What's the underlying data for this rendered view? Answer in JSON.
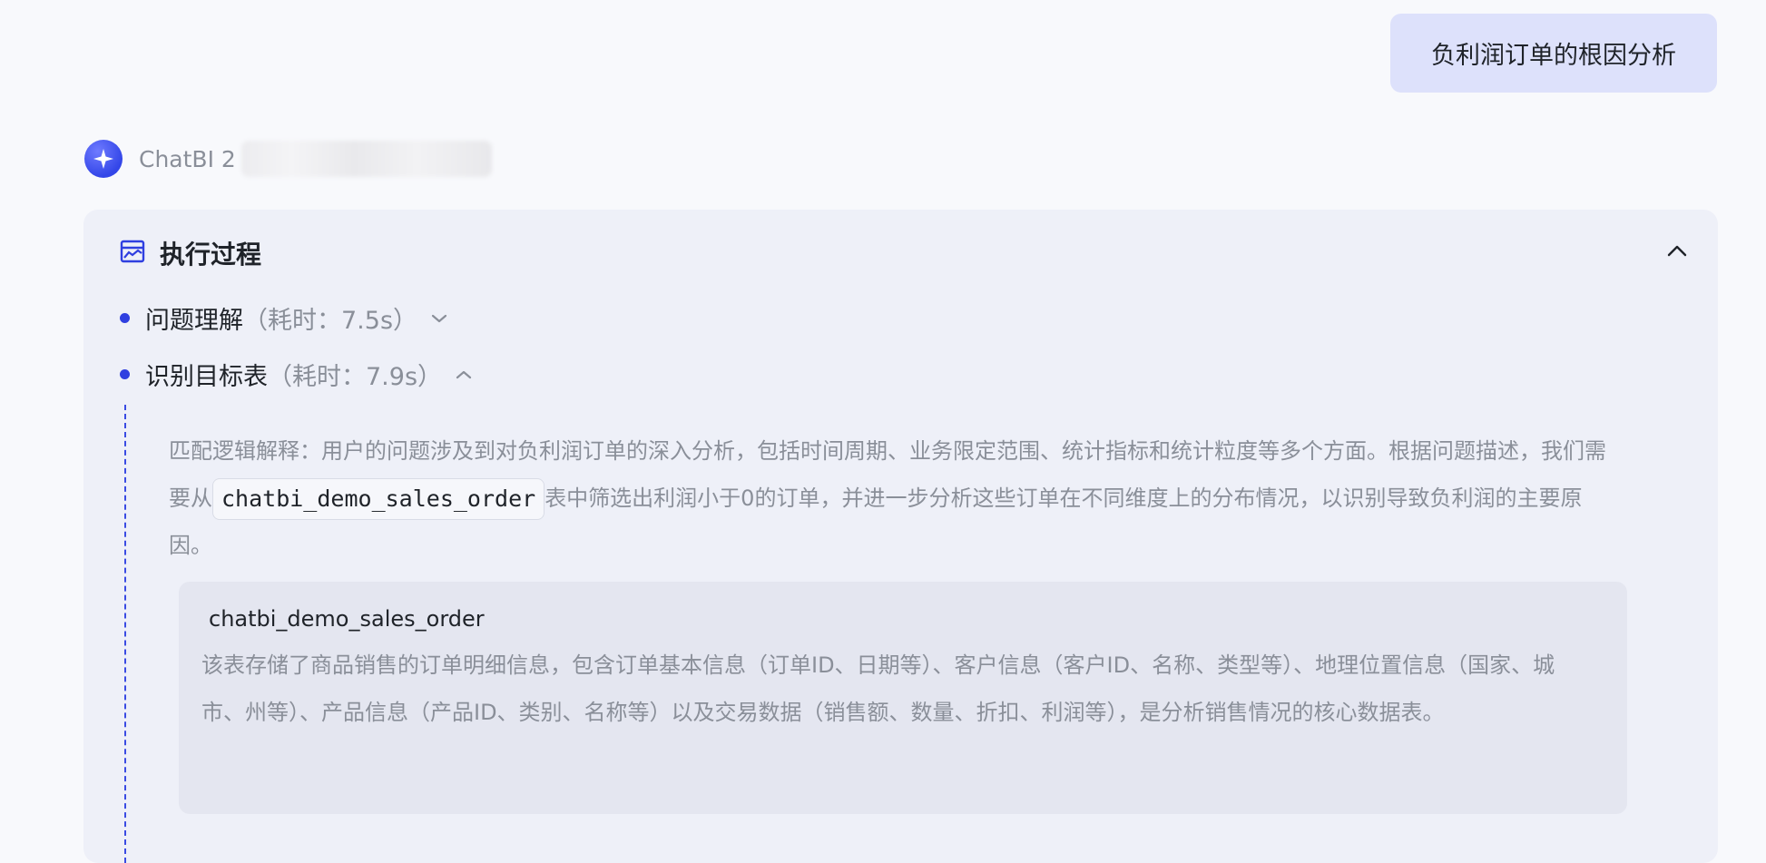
{
  "user_message": "负利润订单的根因分析",
  "bot": {
    "name": "ChatBI 2",
    "avatar_icon": "sparkle-icon"
  },
  "panel": {
    "title": "执行过程",
    "title_icon": "chart-window-icon",
    "collapse_icon": "chevron-up-icon",
    "steps": [
      {
        "name": "问题理解",
        "time": "（耗时：7.5s）",
        "expanded": false
      },
      {
        "name": "识别目标表",
        "time": "（耗时：7.9s）",
        "expanded": true
      }
    ],
    "explanation": {
      "before": "匹配逻辑解释：用户的问题涉及到对负利润订单的深入分析，包括时间周期、业务限定范围、统计指标和统计粒度等多个方面。根据问题描述，我们需要从",
      "code": "chatbi_demo_sales_order",
      "after": "表中筛选出利润小于0的订单，并进一步分析这些订单在不同维度上的分布情况，以识别导致负利润的主要原因。"
    },
    "table": {
      "name": "chatbi_demo_sales_order",
      "description": "该表存储了商品销售的订单明细信息，包含订单基本信息（订单ID、日期等）、客户信息（客户ID、名称、类型等）、地理位置信息（国家、城市、州等）、产品信息（产品ID、类别、名称等）以及交易数据（销售额、数量、折扣、利润等），是分析销售情况的核心数据表。"
    }
  },
  "colors": {
    "accent": "#2f3fe0",
    "bubble": "#dde1fb",
    "panel": "#eef0f8",
    "card": "#e4e6f0"
  }
}
